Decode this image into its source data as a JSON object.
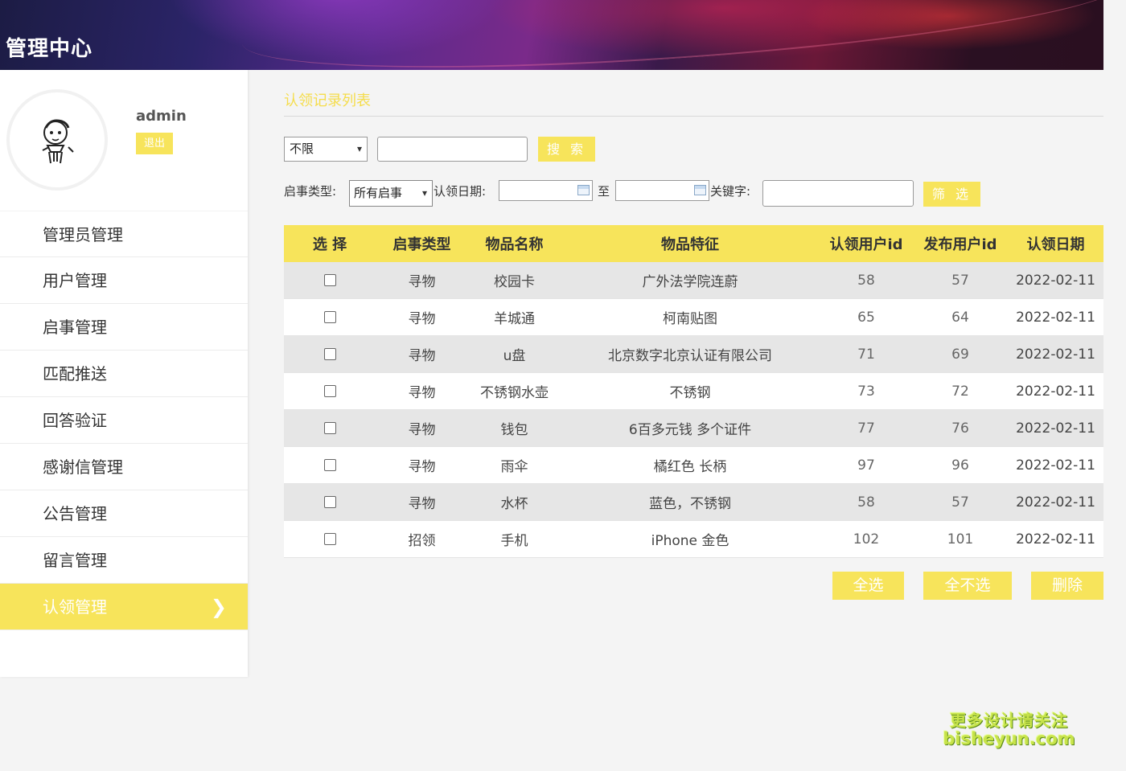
{
  "header": {
    "title": "管理中心"
  },
  "profile": {
    "username": "admin",
    "logout_label": "退出"
  },
  "nav": {
    "items": [
      {
        "label": "管理员管理"
      },
      {
        "label": "用户管理"
      },
      {
        "label": "启事管理"
      },
      {
        "label": "匹配推送"
      },
      {
        "label": "回答验证"
      },
      {
        "label": "感谢信管理"
      },
      {
        "label": "公告管理"
      },
      {
        "label": "留言管理"
      },
      {
        "label": "认领管理",
        "active": true
      }
    ]
  },
  "main": {
    "title": "认领记录列表",
    "search": {
      "scope_value": "不限",
      "input_value": "",
      "button_label": "搜 索"
    },
    "filter": {
      "type_label": "启事类型:",
      "type_value": "所有启事",
      "date_label": "认领日期:",
      "date_from": "",
      "date_to_label": "至",
      "date_to": "",
      "keyword_label": "关键字:",
      "keyword_value": "",
      "button_label": "筛 选"
    },
    "table": {
      "columns": [
        "选 择",
        "启事类型",
        "物品名称",
        "物品特征",
        "认领用户id",
        "发布用户id",
        "认领日期"
      ],
      "rows": [
        {
          "type": "寻物",
          "name": "校园卡",
          "feature": "广外法学院连蔚",
          "claim_uid": "58",
          "post_uid": "57",
          "date": "2022-02-11"
        },
        {
          "type": "寻物",
          "name": "羊城通",
          "feature": "柯南贴图",
          "claim_uid": "65",
          "post_uid": "64",
          "date": "2022-02-11"
        },
        {
          "type": "寻物",
          "name": "u盘",
          "feature": "北京数字北京认证有限公司",
          "claim_uid": "71",
          "post_uid": "69",
          "date": "2022-02-11"
        },
        {
          "type": "寻物",
          "name": "不锈钢水壶",
          "feature": "不锈钢",
          "claim_uid": "73",
          "post_uid": "72",
          "date": "2022-02-11"
        },
        {
          "type": "寻物",
          "name": "钱包",
          "feature": "6百多元钱 多个证件",
          "claim_uid": "77",
          "post_uid": "76",
          "date": "2022-02-11"
        },
        {
          "type": "寻物",
          "name": "雨伞",
          "feature": "橘红色 长柄",
          "claim_uid": "97",
          "post_uid": "96",
          "date": "2022-02-11"
        },
        {
          "type": "寻物",
          "name": "水杯",
          "feature": "蓝色，不锈钢",
          "claim_uid": "58",
          "post_uid": "57",
          "date": "2022-02-11"
        },
        {
          "type": "招领",
          "name": "手机",
          "feature": "iPhone 金色",
          "claim_uid": "102",
          "post_uid": "101",
          "date": "2022-02-11"
        }
      ]
    },
    "actions": {
      "select_all": "全选",
      "select_none": "全不选",
      "delete": "删除"
    }
  },
  "watermark": {
    "line1": "更多设计请关注",
    "line2": "bisheyun.com"
  },
  "colors": {
    "accent": "#f7e45b",
    "title": "#f5dd4c"
  },
  "icons": {
    "nav_active": "chevron-right-icon",
    "date_picker": "calendar-icon",
    "select": "chevron-down-icon"
  }
}
